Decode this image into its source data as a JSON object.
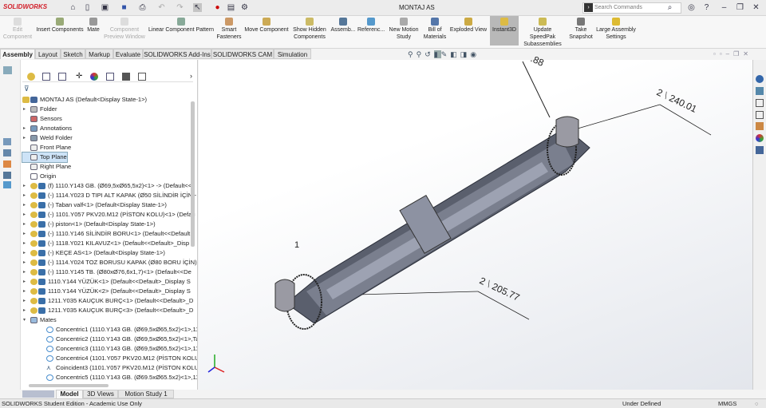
{
  "app": {
    "logo": "SOLIDWORKS",
    "document_title": "MONTAJ AS",
    "search_placeholder": "Search Commands"
  },
  "ribbon": [
    {
      "label": "Edit Component",
      "disabled": true
    },
    {
      "label": "Insert Components"
    },
    {
      "label": "Mate"
    },
    {
      "label": "Component Preview Window",
      "disabled": true
    },
    {
      "label": "Linear Component Pattern"
    },
    {
      "label": "Smart Fasteners"
    },
    {
      "label": "Move Component"
    },
    {
      "label": "Show Hidden Components"
    },
    {
      "label": "Assemb..."
    },
    {
      "label": "Referenc..."
    },
    {
      "label": "New Motion Study"
    },
    {
      "label": "Bill of Materials"
    },
    {
      "label": "Exploded View"
    },
    {
      "label": "Instant3D",
      "active": true
    },
    {
      "label": "Update SpeedPak Subassemblies"
    },
    {
      "label": "Take Snapshot"
    },
    {
      "label": "Large Assembly Settings"
    }
  ],
  "tabs": [
    "Assembly",
    "Layout",
    "Sketch",
    "Markup",
    "Evaluate",
    "SOLIDWORKS Add-Ins",
    "SOLIDWORKS CAM",
    "Simulation"
  ],
  "tree": {
    "root": "MONTAJ AS  (Default<Display State-1>)",
    "items": [
      {
        "label": "Folder",
        "type": "folder",
        "expand": true
      },
      {
        "label": "Sensors",
        "type": "sensor"
      },
      {
        "label": "Annotations",
        "type": "annot",
        "expand": true
      },
      {
        "label": "Weld Folder",
        "type": "weld",
        "expand": true
      },
      {
        "label": "Front Plane",
        "type": "plane"
      },
      {
        "label": "Top Plane",
        "type": "plane",
        "selected": true
      },
      {
        "label": "Right Plane",
        "type": "plane"
      },
      {
        "label": "Origin",
        "type": "origin"
      },
      {
        "label": "(f) 1110.Y143 GB. (Ø69,5xØ65,5x2)<1> -> (Default<<",
        "type": "part",
        "expand": true
      },
      {
        "label": "(-) 1114.Y023 D TIPI ALT KAPAK (Ø50 SİLİNDİR İÇİN)-",
        "type": "part",
        "expand": true
      },
      {
        "label": "(-) Taban valf<1> (Default<Display State-1>)",
        "type": "part",
        "expand": true
      },
      {
        "label": "(-) 1101.Y057 PKV20.M12 (PİSTON KOLU)<1> (Defau",
        "type": "part",
        "expand": true
      },
      {
        "label": "(-) piston<1> (Default<Display State-1>)",
        "type": "part",
        "expand": true
      },
      {
        "label": "(-) 1110.Y146 SİLİNDİR BORU<1> (Default<<Default",
        "type": "part",
        "expand": true
      },
      {
        "label": "(-) 1118.Y021 KILAVUZ<1> (Default<<Default>_Disp",
        "type": "part",
        "expand": true
      },
      {
        "label": "(-) KEÇE AS<1> (Default<Display State-1>)",
        "type": "part",
        "expand": true
      },
      {
        "label": "(-) 1114.Y024 TOZ BORUSU KAPAK (Ø80 BORU İÇİN)",
        "type": "part",
        "expand": true
      },
      {
        "label": "(-) 1110.Y145 TB. (Ø80xØ76,6x1,7)<1> (Default<<De",
        "type": "part",
        "expand": true
      },
      {
        "label": "1110.Y144 YÜZÜK<1> (Default<<Default>_Display S",
        "type": "part",
        "expand": true
      },
      {
        "label": "1110.Y144 YÜZÜK<2> (Default<<Default>_Display S",
        "type": "part",
        "expand": true
      },
      {
        "label": "1211.Y035 KAUÇUK BURÇ<1> (Default<<Default>_D",
        "type": "part",
        "expand": true
      },
      {
        "label": "1211.Y035 KAUÇUK BURÇ<3> (Default<<Default>_D",
        "type": "part",
        "expand": true
      },
      {
        "label": "Mates",
        "type": "mates",
        "open": true
      },
      {
        "label": "Concentric1 (1110.Y143 GB. (Ø69,5xØ65,5x2)<1>,111",
        "type": "mate"
      },
      {
        "label": "Concentric2 (1110.Y143 GB. (Ø69,5xØ65,5x2)<1>,Tab",
        "type": "mate"
      },
      {
        "label": "Concentric3 (1110.Y143 GB. (Ø69,5xØ65,5x2)<1>,110",
        "type": "mate"
      },
      {
        "label": "Concentric4 (1101.Y057 PKV20.M12 (PİSTON KOLU)<",
        "type": "mate"
      },
      {
        "label": "Coincident3 (1101.Y057 PKV20.M12 (PİSTON KOLU)<",
        "type": "coinc"
      },
      {
        "label": "Concentric5 (1110.Y143 GB. (Ø69.5xØ65.5x2)<1>,111",
        "type": "mate"
      }
    ]
  },
  "viewport": {
    "dims": [
      {
        "count": "2",
        "value": "240.01"
      },
      {
        "count": "2",
        "value": "205.77"
      },
      {
        "count": "1",
        "value": ""
      },
      {
        "count": "",
        "value": ".88"
      }
    ]
  },
  "bottom_tabs": [
    "Model",
    "3D Views",
    "Motion Study 1"
  ],
  "status": {
    "left": "SOLIDWORKS Student Edition - Academic Use Only",
    "state": "Under Defined",
    "units": "MMGS"
  }
}
